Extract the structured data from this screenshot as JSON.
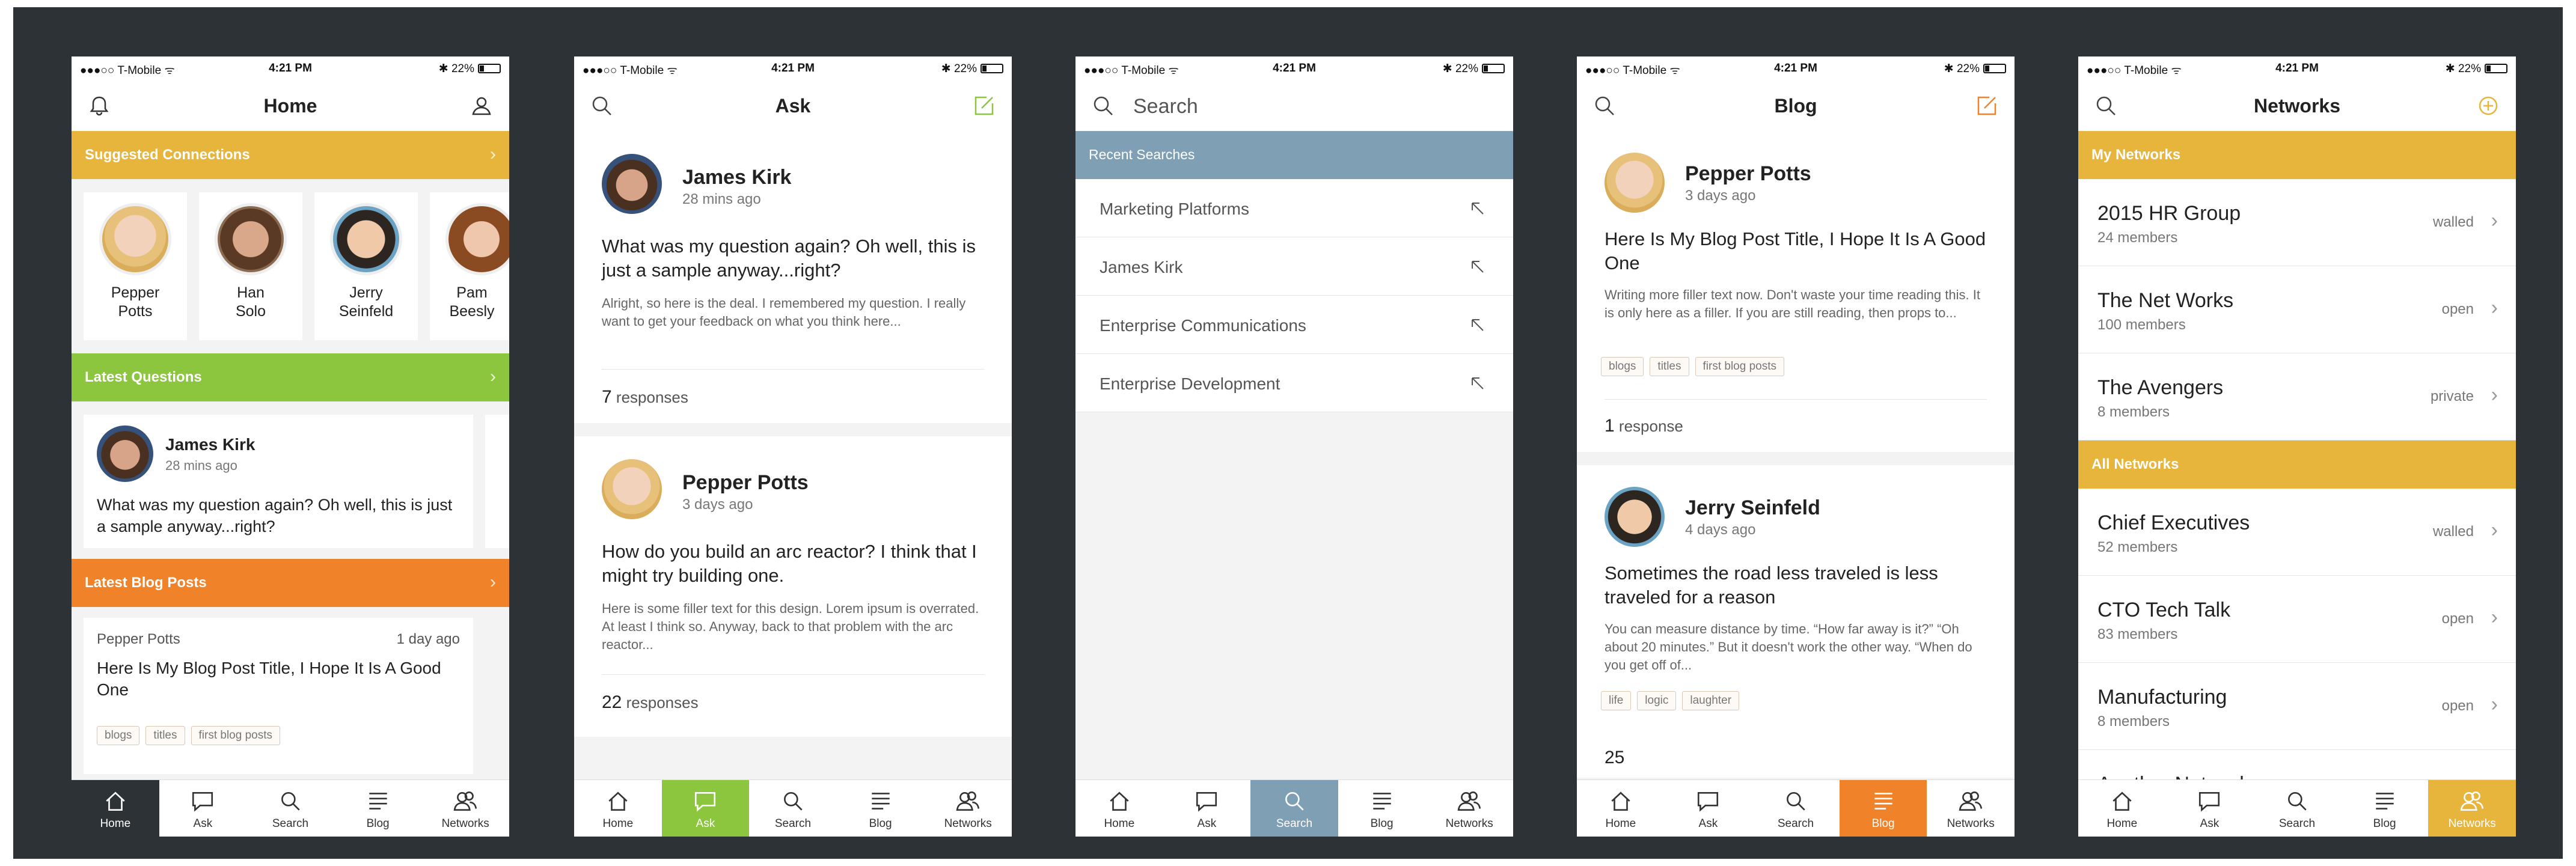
{
  "status": {
    "carrier": "●●●○○ T-Mobile ᯤ",
    "time": "4:21 PM",
    "battery": "✱ 22%"
  },
  "colors": {
    "gold": "#e7b43c",
    "green": "#8cc63f",
    "orange": "#f0832a",
    "slate": "#7f9fb5",
    "background": "#2c3236"
  },
  "tabs": [
    "Home",
    "Ask",
    "Search",
    "Blog",
    "Networks"
  ],
  "home": {
    "title": "Home",
    "suggested_label": "Suggested Connections",
    "connections": [
      {
        "first": "Pepper",
        "last": "Potts"
      },
      {
        "first": "Han",
        "last": "Solo"
      },
      {
        "first": "Jerry",
        "last": "Seinfeld"
      },
      {
        "first": "Pam",
        "last": "Beesly"
      }
    ],
    "questions_label": "Latest Questions",
    "question": {
      "author": "James Kirk",
      "time": "28 mins ago",
      "text": "What was my question again? Oh well, this is just a sample anyway...right?"
    },
    "blog_label": "Latest Blog Posts",
    "blog": {
      "author": "Pepper Potts",
      "time": "1 day ago",
      "title": "Here Is My Blog Post Title, I Hope It Is A Good One",
      "tags": [
        "blogs",
        "titles",
        "first blog posts"
      ]
    }
  },
  "ask": {
    "title": "Ask",
    "posts": [
      {
        "author": "James Kirk",
        "time": "28 mins ago",
        "question": "What was my question again? Oh well, this is just a sample anyway...right?",
        "body": "Alright, so here is the deal. I remembered my question. I really want to get your feedback on what you think here...",
        "count": "7",
        "count_label": "responses"
      },
      {
        "author": "Pepper Potts",
        "time": "3 days ago",
        "question": "How do you build an arc reactor? I think that I might try building one.",
        "body": "Here is some filler text for this design. Lorem ipsum is overrated. At least I think so. Anyway, back to that problem with the arc reactor...",
        "count": "22",
        "count_label": "responses"
      }
    ]
  },
  "search": {
    "placeholder": "Search",
    "recent_label": "Recent Searches",
    "items": [
      "Marketing Platforms",
      "James Kirk",
      "Enterprise Communications",
      "Enterprise Development"
    ]
  },
  "blogscreen": {
    "title": "Blog",
    "posts": [
      {
        "author": "Pepper Potts",
        "time": "3 days ago",
        "title": "Here Is My Blog Post Title, I Hope It Is A Good One",
        "body": "Writing more filler text now. Don't waste your time reading this. It is only here as a filler. If you are still reading, then props to...",
        "tags": [
          "blogs",
          "titles",
          "first blog posts"
        ],
        "count": "1",
        "count_label": "response"
      },
      {
        "author": "Jerry Seinfeld",
        "time": "4 days ago",
        "title": "Sometimes the road less traveled is less traveled for a reason",
        "body": "You can measure distance by time. “How far away is it?” “Oh about 20 minutes.” But it doesn't work the other way. “When do you get off of...",
        "tags": [
          "life",
          "logic",
          "laughter"
        ],
        "count": "25",
        "count_label": ""
      }
    ]
  },
  "networks": {
    "title": "Networks",
    "my_label": "My Networks",
    "my": [
      {
        "name": "2015 HR Group",
        "members": "24 members",
        "status": "walled"
      },
      {
        "name": "The Net Works",
        "members": "100 members",
        "status": "open"
      },
      {
        "name": "The Avengers",
        "members": "8 members",
        "status": "private"
      }
    ],
    "all_label": "All Networks",
    "all": [
      {
        "name": "Chief Executives",
        "members": "52 members",
        "status": "walled"
      },
      {
        "name": "CTO Tech Talk",
        "members": "83 members",
        "status": "open"
      },
      {
        "name": "Manufacturing",
        "members": "8 members",
        "status": "open"
      },
      {
        "name": "Another Network",
        "members": "",
        "status": ""
      }
    ]
  }
}
